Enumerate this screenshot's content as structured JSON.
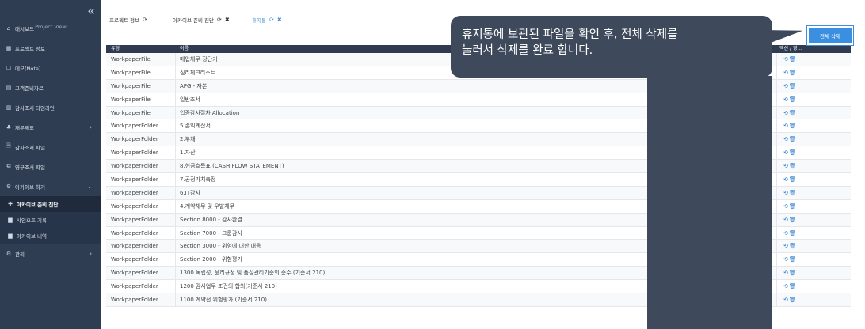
{
  "sidebar": {
    "collapse_glyph": "«",
    "project_view_label": "Project View",
    "items": [
      {
        "label": "대시보드",
        "icon": "house-icon",
        "glyph": "⌂"
      },
      {
        "label": "프로젝트 정보",
        "icon": "table-icon",
        "glyph": "▦"
      },
      {
        "label": "메모(Note)",
        "icon": "memo-icon",
        "glyph": "☐"
      },
      {
        "label": "고객준비자료",
        "icon": "folder-icon",
        "glyph": "▤"
      },
      {
        "label": "감사조서 타임라인",
        "icon": "calendar-icon",
        "glyph": "▥"
      },
      {
        "label": "재무제표",
        "icon": "sitemap-icon",
        "glyph": "♣",
        "chevron": "›"
      },
      {
        "label": "감사조서 파일",
        "icon": "file-icon",
        "glyph": "🗎"
      },
      {
        "label": "영구조서 파일",
        "icon": "copy-icon",
        "glyph": "⧉"
      },
      {
        "label": "아카이브 하기",
        "icon": "gear-icon",
        "glyph": "⚙",
        "chevron": "⌄"
      }
    ],
    "submenu": [
      {
        "label": "아카이브 준비 진단",
        "icon": "stethoscope-icon",
        "glyph": "✚",
        "active": true
      },
      {
        "label": "사인오프 기록",
        "icon": "list-icon",
        "glyph": "▆"
      },
      {
        "label": "아카이브 내역",
        "icon": "list-icon",
        "glyph": "▆"
      }
    ],
    "bottom_item": {
      "label": "관리",
      "icon": "gear-icon",
      "glyph": "⚙",
      "chevron": "›"
    }
  },
  "tabs": [
    {
      "label": "프로젝트 정보",
      "icon": "refresh-icon",
      "glyph": "⟳"
    },
    {
      "label": "아카이브 준비 진단",
      "icon": "refresh-icon",
      "glyph": "⟳",
      "close": "✖"
    },
    {
      "label": "휴지통",
      "icon": "refresh-icon",
      "glyph": "⟳",
      "close": "✖",
      "active": true
    }
  ],
  "table": {
    "headers": {
      "type": "유형",
      "name": "이름",
      "actions": "액션 / 영..."
    },
    "rows": [
      {
        "type": "WorkpaperFile",
        "name": "매입채무-장단기"
      },
      {
        "type": "WorkpaperFile",
        "name": "심리체크리스트"
      },
      {
        "type": "WorkpaperFile",
        "name": "APG - 자본"
      },
      {
        "type": "WorkpaperFile",
        "name": "일반조서"
      },
      {
        "type": "WorkpaperFile",
        "name": "입증감사절차 Allocation"
      },
      {
        "type": "WorkpaperFolder",
        "name": "5.손익계산서"
      },
      {
        "type": "WorkpaperFolder",
        "name": "2.부채"
      },
      {
        "type": "WorkpaperFolder",
        "name": "1.자산"
      },
      {
        "type": "WorkpaperFolder",
        "name": "8.현금흐름표 (CASH FLOW STATEMENT)"
      },
      {
        "type": "WorkpaperFolder",
        "name": "7.공정가치측정"
      },
      {
        "type": "WorkpaperFolder",
        "name": "6.IT감사"
      },
      {
        "type": "WorkpaperFolder",
        "name": "4.계약채무 및 우발채무"
      },
      {
        "type": "WorkpaperFolder",
        "name": "Section 8000 - 감사완결"
      },
      {
        "type": "WorkpaperFolder",
        "name": "Section 7000 - 그룹감사"
      },
      {
        "type": "WorkpaperFolder",
        "name": "Section 3000 - 위험에 대한 대응"
      },
      {
        "type": "WorkpaperFolder",
        "name": "Section 2000 - 위험평가"
      },
      {
        "type": "WorkpaperFolder",
        "name": "1300 독립성, 윤리규정 및 품질관리기준의 준수 (기준서 210)"
      },
      {
        "type": "WorkpaperFolder",
        "name": "1200 감사업무 조건의 합의(기준서 210)"
      },
      {
        "type": "WorkpaperFolder",
        "name": "1100 계약전 위험평가 (기준서 210)"
      }
    ],
    "row_actions": "⟲🗑"
  },
  "callout": {
    "line1": "휴지통에 보관된 파일을 확인 후, 전체 삭제를",
    "line2": "눌러서 삭제를 완료 합니다."
  },
  "delete_all_label": "전체 삭제"
}
